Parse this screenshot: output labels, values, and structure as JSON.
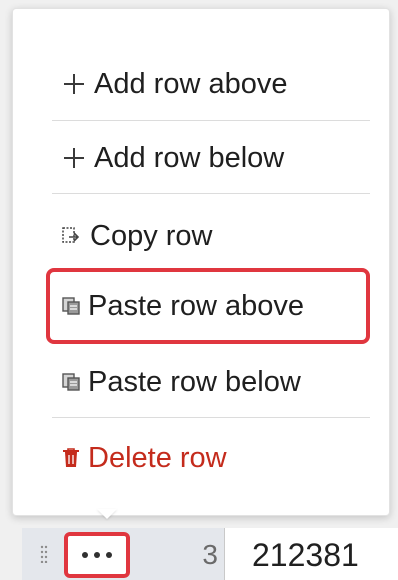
{
  "menu": {
    "items": [
      {
        "label": "Add row above",
        "icon": "plus-icon"
      },
      {
        "label": "Add row below",
        "icon": "plus-icon"
      },
      {
        "label": "Copy row",
        "icon": "copy-icon"
      },
      {
        "label": "Paste row above",
        "icon": "paste-icon"
      },
      {
        "label": "Paste row below",
        "icon": "paste-icon"
      },
      {
        "label": "Delete row",
        "icon": "trash-icon"
      }
    ],
    "highlighted_item": "Paste row above"
  },
  "row": {
    "number": "3",
    "value": "212381",
    "more_icon": "more-options-icon",
    "handle_icon": "drag-handle-icon"
  },
  "colors": {
    "highlight": "#e0363f",
    "danger": "#c42b1c",
    "text": "#1f1f1f"
  }
}
